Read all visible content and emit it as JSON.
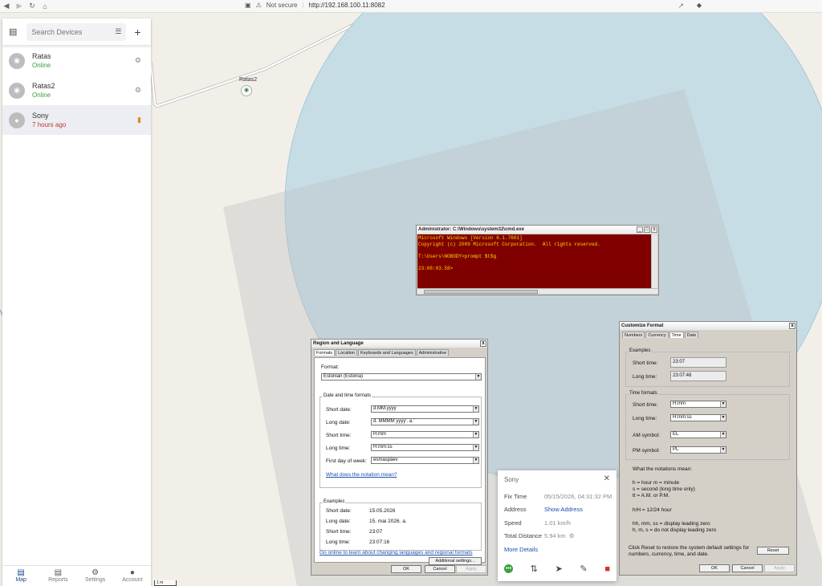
{
  "browser": {
    "security": "Not secure",
    "url": "http://192.168.100.11:8082"
  },
  "sidebar": {
    "search_placeholder": "Search Devices",
    "devices": [
      {
        "name": "Ratas",
        "status": "Online",
        "icon": "bike-icon"
      },
      {
        "name": "Ratas2",
        "status": "Online",
        "icon": "bike-icon"
      },
      {
        "name": "Sony",
        "status": "7 hours ago",
        "icon": "pin-icon"
      }
    ],
    "tabs": [
      {
        "label": "Map",
        "icon": "map-icon"
      },
      {
        "label": "Reports",
        "icon": "report-icon"
      },
      {
        "label": "Settings",
        "icon": "gear-icon"
      },
      {
        "label": "Account",
        "icon": "person-icon"
      }
    ]
  },
  "map": {
    "marker_label": "Ratas2",
    "scale": "1 m"
  },
  "cmd": {
    "title": "Administrator: C:\\Windows\\system32\\cmd.exe",
    "lines": [
      "Microsoft Windows [Version 6.1.7601]",
      "Copyright (c) 2009 Microsoft Corporation.  All rights reserved.",
      "",
      "T:\\Users\\NOBODY>prompt $t$g",
      "",
      "23:08:03.58>"
    ]
  },
  "region": {
    "title": "Region and Language",
    "tabs": [
      "Formats",
      "Location",
      "Keyboards and Languages",
      "Administrative"
    ],
    "format_label": "Format:",
    "format_value": "Estonian (Estonia)",
    "dt_group": "Date and time formats",
    "rows": [
      {
        "label": "Short date:",
        "value": "d.MM.yyyy"
      },
      {
        "label": "Long date:",
        "value": "d. MMMM yyyy'. a.'"
      },
      {
        "label": "Short time:",
        "value": "H:mm"
      },
      {
        "label": "Long time:",
        "value": "H:mm:ss"
      },
      {
        "label": "First day of week:",
        "value": "esmaspäev"
      }
    ],
    "notation_link": "What does the notation mean?",
    "examples_group": "Examples",
    "examples": [
      {
        "label": "Short date:",
        "value": "15.05.2026"
      },
      {
        "label": "Long date:",
        "value": "15. mai 2026. a."
      },
      {
        "label": "Short time:",
        "value": "23:07"
      },
      {
        "label": "Long time:",
        "value": "23:07:16"
      }
    ],
    "additional_btn": "Additional settings...",
    "online_link": "Go online to learn about changing languages and regional formats",
    "ok": "OK",
    "cancel": "Cancel",
    "apply": "Apply"
  },
  "customize": {
    "title": "Customize Format",
    "tabs": [
      "Numbers",
      "Currency",
      "Time",
      "Date"
    ],
    "examples_group": "Examples",
    "short_time_label": "Short time:",
    "short_time_example": "23:07",
    "long_time_label": "Long time:",
    "long_time_example": "23:07:48",
    "formats_group": "Time formats",
    "short_time_value": "H:mm",
    "long_time_value": "H:mm:ss",
    "am_label": "AM symbol:",
    "am_value": "EL",
    "pm_label": "PM symbol:",
    "pm_value": "PL",
    "notation_head": "What the notations mean:",
    "notation_lines": [
      "h = hour   m = minute",
      "s = second (long time only)",
      "tt = A.M. or P.M.",
      "",
      "h/H = 12/24 hour",
      "",
      "hh, mm, ss = display leading zero",
      "h, m, s = do not display leading zero"
    ],
    "reset_text_1": "Click Reset to restore the system default settings for",
    "reset_text_2": "numbers, currency, time, and date.",
    "reset": "Reset",
    "ok": "OK",
    "cancel": "Cancel",
    "apply": "Apply"
  },
  "popup": {
    "title": "Sony",
    "rows": [
      {
        "key": "Fix Time",
        "value": "05/15/2026, 04:31:32 PM"
      },
      {
        "key": "Address",
        "value": "Show Address"
      },
      {
        "key": "Speed",
        "value": "1.01 km/h"
      },
      {
        "key": "Total Distance",
        "value": "5.94 km"
      }
    ],
    "more": "More Details"
  },
  "colors": {
    "accent": "#1a4a8a",
    "online": "#3a9c3a",
    "offline": "#c0392b",
    "circle": "#c6dde6",
    "cmd_bg": "#800000",
    "cmd_fg": "#ffd700"
  }
}
